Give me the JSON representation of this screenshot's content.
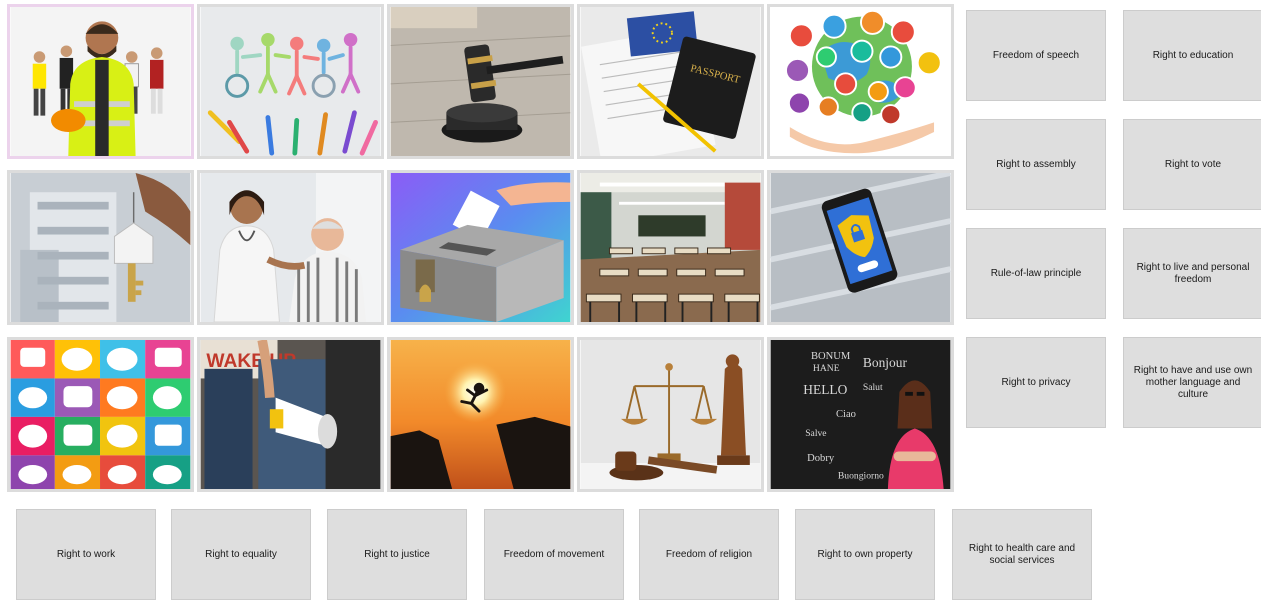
{
  "images": [
    {
      "id": "workers"
    },
    {
      "id": "paper-people-wheelchair"
    },
    {
      "id": "judge-gavel"
    },
    {
      "id": "passport"
    },
    {
      "id": "religion-symbols"
    },
    {
      "id": "house-key"
    },
    {
      "id": "nurse-elderly"
    },
    {
      "id": "ballot-box"
    },
    {
      "id": "classroom"
    },
    {
      "id": "smartphone-shield"
    },
    {
      "id": "speech-bubbles"
    },
    {
      "id": "protest-megaphone",
      "sign_text": "WAKE UP"
    },
    {
      "id": "jump-cliffs"
    },
    {
      "id": "justice-scales"
    },
    {
      "id": "languages-chalkboard",
      "chalk_words": [
        "BONUM",
        "HANE",
        "Bonjour",
        "HELLO",
        "Salut",
        "Ciao",
        "Salve",
        "Dobry",
        "Buongiorno"
      ]
    }
  ],
  "cards": [
    {
      "label": "Freedom of speech"
    },
    {
      "label": "Right to education"
    },
    {
      "label": "Right to assembly"
    },
    {
      "label": "Right to vote"
    },
    {
      "label": "Rule-of-law principle"
    },
    {
      "label": "Right to live and personal freedom"
    },
    {
      "label": "Right to privacy"
    },
    {
      "label": "Right to have and use own mother language and culture"
    },
    {
      "label": "Right to work"
    },
    {
      "label": "Right to equality"
    },
    {
      "label": "Right to justice"
    },
    {
      "label": "Freedom of movement"
    },
    {
      "label": "Freedom of religion"
    },
    {
      "label": "Right to own property"
    },
    {
      "label": "Right to health care and social services"
    }
  ],
  "icon_names": [
    "workers-image",
    "paper-people-image",
    "gavel-image",
    "passport-image",
    "religion-symbols-image",
    "house-key-image",
    "nurse-elderly-image",
    "ballot-box-image",
    "classroom-image",
    "phone-shield-image",
    "speech-bubbles-image",
    "megaphone-image",
    "jump-image",
    "scales-image",
    "chalkboard-image"
  ],
  "colors": {
    "tile_border": "#dcdcdc",
    "tile_selected_border": "#ecd3ec",
    "card_bg": "#dedede",
    "card_border": "#cccccc"
  },
  "passport_label": "PASSPORT"
}
